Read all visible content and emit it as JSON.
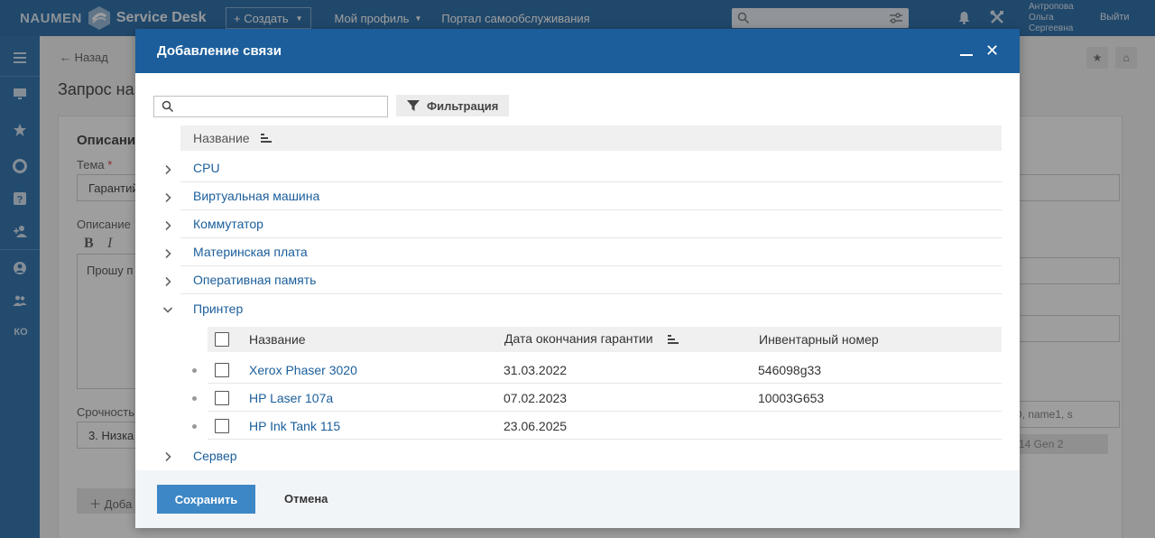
{
  "topbar": {
    "brand_left": "NAUMEN",
    "brand_right": "Service Desk",
    "create_label": "+ Создать",
    "my_profile": "Мой профиль",
    "portal": "Портал самообслуживания",
    "user_line1": "Антропова",
    "user_line2": "Ольга",
    "user_line3": "Сергеевна",
    "logout": "Выйти",
    "icons": [
      "search-icon",
      "settings-sliders-icon",
      "bell-icon",
      "tools-icon"
    ]
  },
  "sidebar": {
    "items": [
      "menu-icon",
      "monitor-icon",
      "star-icon",
      "lifebuoy-icon",
      "help-icon",
      "user-plus-icon",
      "user-icon",
      "users-icon"
    ],
    "ko_label": "КО"
  },
  "background": {
    "back": "← Назад",
    "title": "Запрос на",
    "section": "Описание",
    "topic_label": "Тема",
    "topic_value": "Гарантий",
    "description_label": "Описание",
    "description_value": "Прошу п",
    "urgency_label": "Срочность",
    "urgency_value": "3. Низка",
    "add_button": "Доба",
    "right_text1": "D, name1, s",
    "right_text2": "14 Gen 2"
  },
  "modal": {
    "title": "Добавление связи",
    "search_placeholder": "",
    "filter_label": "Фильтрация",
    "column_header": "Название",
    "groups": [
      {
        "label": "CPU",
        "expanded": false
      },
      {
        "label": "Виртуальная машина",
        "expanded": false
      },
      {
        "label": "Коммутатор",
        "expanded": false
      },
      {
        "label": "Материнская плата",
        "expanded": false
      },
      {
        "label": "Оперативная память",
        "expanded": false
      },
      {
        "label": "Принтер",
        "expanded": true
      },
      {
        "label": "Сервер",
        "expanded": false
      }
    ],
    "sub_table": {
      "headers": {
        "name": "Название",
        "warranty": "Дата окончания гарантии",
        "inventory": "Инвентарный номер"
      },
      "rows": [
        {
          "name": "Xerox Phaser 3020",
          "warranty": "31.03.2022",
          "inventory": "546098g33"
        },
        {
          "name": "HP Laser 107a",
          "warranty": "07.02.2023",
          "inventory": "10003G653"
        },
        {
          "name": "HP Ink Tank 115",
          "warranty": "23.06.2025",
          "inventory": ""
        }
      ]
    },
    "save_label": "Сохранить",
    "cancel_label": "Отмена"
  },
  "colors": {
    "topbar": "#1b63a3",
    "modal_header": "#1b5e9b",
    "link": "#1b5e9b",
    "primary_button": "#3d87c6"
  }
}
